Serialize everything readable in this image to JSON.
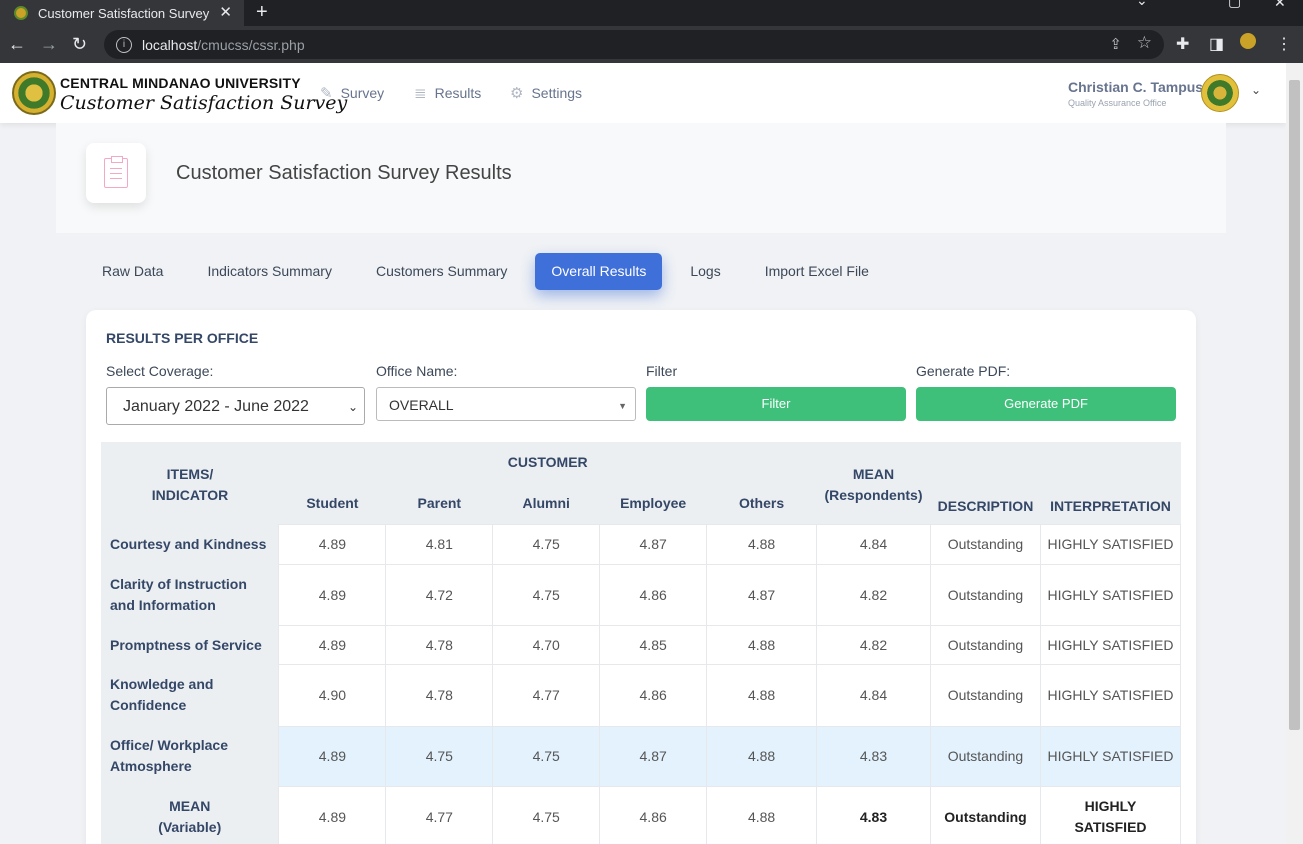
{
  "browser": {
    "tab_title": "Customer Satisfaction Survey",
    "url_host": "localhost",
    "url_path": "/cmucss/cssr.php"
  },
  "navbar": {
    "brand_line1": "CENTRAL MINDANAO UNIVERSITY",
    "brand_line2": "Customer Satisfaction Survey",
    "menu": [
      {
        "label": "Survey",
        "icon": "edit-icon"
      },
      {
        "label": "Results",
        "icon": "database-icon"
      },
      {
        "label": "Settings",
        "icon": "gear-icon"
      }
    ],
    "user_name": "Christian C. Tampus",
    "user_office": "Quality Assurance Office"
  },
  "header": {
    "title": "Customer Satisfaction Survey Results"
  },
  "tabs": [
    "Raw Data",
    "Indicators Summary",
    "Customers Summary",
    "Overall Results",
    "Logs",
    "Import Excel File"
  ],
  "active_tab": "Overall Results",
  "results": {
    "section_title": "RESULTS PER OFFICE",
    "coverage_label": "Select Coverage:",
    "coverage_value": "January 2022 - June 2022",
    "office_label": "Office Name:",
    "office_value": "OVERALL",
    "filter_label": "Filter",
    "filter_button": "Filter",
    "pdf_label": "Generate PDF:",
    "pdf_button": "Generate PDF"
  },
  "table": {
    "header_items": "ITEMS/\nINDICATOR",
    "header_customer": "CUSTOMER",
    "customer_cols": [
      "Student",
      "Parent",
      "Alumni",
      "Employee",
      "Others"
    ],
    "header_mean": "MEAN\n(Respondents)",
    "header_description": "DESCRIPTION",
    "header_interpretation": "INTERPRETATION",
    "rows": [
      {
        "item": "Courtesy and Kindness",
        "values": [
          "4.89",
          "4.81",
          "4.75",
          "4.87",
          "4.88"
        ],
        "mean": "4.84",
        "description": "Outstanding",
        "interpretation": "HIGHLY SATISFIED"
      },
      {
        "item": "Clarity of Instruction and Information",
        "values": [
          "4.89",
          "4.72",
          "4.75",
          "4.86",
          "4.87"
        ],
        "mean": "4.82",
        "description": "Outstanding",
        "interpretation": "HIGHLY SATISFIED"
      },
      {
        "item": "Promptness of Service",
        "values": [
          "4.89",
          "4.78",
          "4.70",
          "4.85",
          "4.88"
        ],
        "mean": "4.82",
        "description": "Outstanding",
        "interpretation": "HIGHLY SATISFIED"
      },
      {
        "item": "Knowledge and Confidence",
        "values": [
          "4.90",
          "4.78",
          "4.77",
          "4.86",
          "4.88"
        ],
        "mean": "4.84",
        "description": "Outstanding",
        "interpretation": "HIGHLY SATISFIED"
      },
      {
        "item": "Office/ Workplace Atmosphere",
        "values": [
          "4.89",
          "4.75",
          "4.75",
          "4.87",
          "4.88"
        ],
        "mean": "4.83",
        "description": "Outstanding",
        "interpretation": "HIGHLY SATISFIED"
      }
    ],
    "mean_row": {
      "item": "MEAN\n(Variable)",
      "values": [
        "4.89",
        "4.77",
        "4.75",
        "4.86",
        "4.88"
      ],
      "mean": "4.83",
      "description": "Outstanding",
      "interpretation": "HIGHLY\nSATISFIED"
    }
  }
}
